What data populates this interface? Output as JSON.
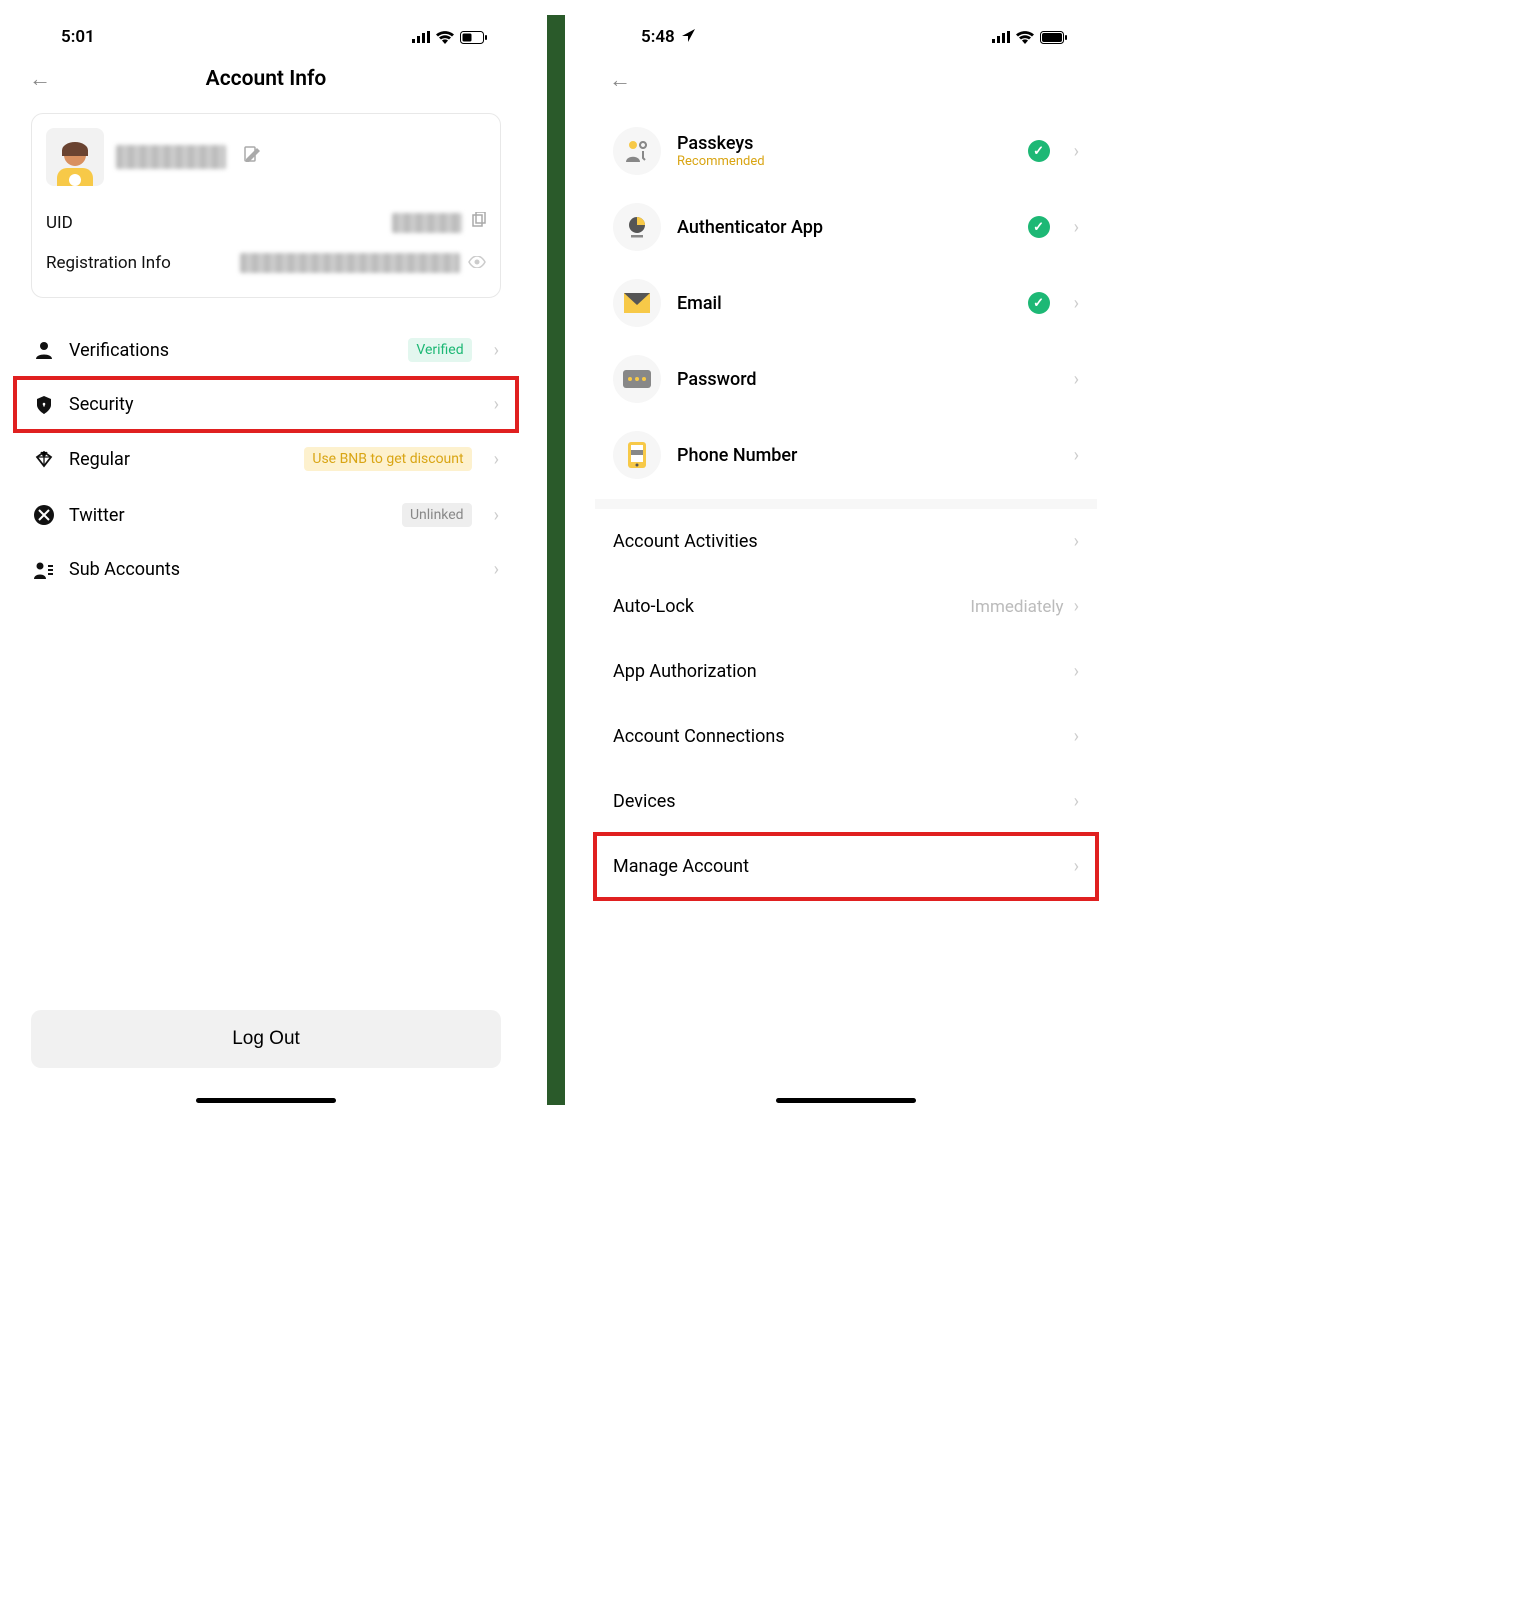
{
  "left": {
    "status_time": "5:01",
    "back": "←",
    "title": "Account Info",
    "uid_label": "UID",
    "reg_label": "Registration Info",
    "menu": {
      "verifications": {
        "label": "Verifications",
        "badge": "Verified"
      },
      "security": {
        "label": "Security"
      },
      "regular": {
        "label": "Regular",
        "badge": "Use BNB to get discount"
      },
      "twitter": {
        "label": "Twitter",
        "badge": "Unlinked"
      },
      "sub": {
        "label": "Sub Accounts"
      }
    },
    "logout": "Log Out"
  },
  "right": {
    "status_time": "5:48",
    "back": "←",
    "items": {
      "passkeys": {
        "title": "Passkeys",
        "sub": "Recommended",
        "check": true
      },
      "auth": {
        "title": "Authenticator App",
        "check": true
      },
      "email": {
        "title": "Email",
        "check": true
      },
      "password": {
        "title": "Password",
        "check": false
      },
      "phone": {
        "title": "Phone Number",
        "check": false
      }
    },
    "plain": {
      "activities": "Account Activities",
      "autolock": {
        "label": "Auto-Lock",
        "value": "Immediately"
      },
      "appauth": "App Authorization",
      "connections": "Account Connections",
      "devices": "Devices",
      "manage": "Manage Account"
    }
  }
}
